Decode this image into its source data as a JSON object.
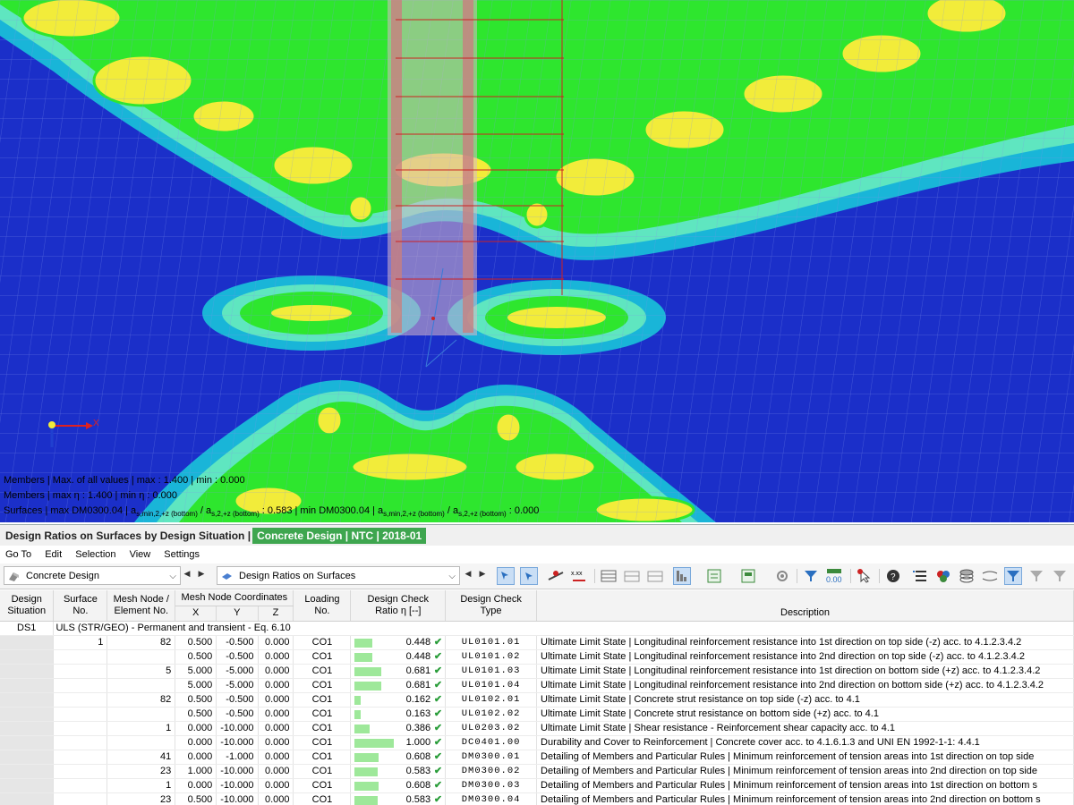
{
  "viewport": {
    "info_lines": [
      {
        "prefix": "Members | Max. of all values | max",
        "mid": ": 1.400 | min",
        "suffix": ": 0.000"
      },
      {
        "prefix": "Members | max η : 1.400 | min η : 0.000"
      },
      {
        "prefix": "Surfaces | max DM0300.04 | a",
        "sub1": "s,min,2,+z (bottom)",
        "mid1": " / a",
        "sub2": "s,2,+z (bottom)",
        "mid2": " : 0.583 | min DM0300.04 | a",
        "sub3": "s,min,2,+z (bottom)",
        "mid3": " / a",
        "sub4": "s,2,+z (bottom)",
        "suffix": " : 0.000"
      }
    ],
    "axis_x_label": "X"
  },
  "panel": {
    "title": "Design Ratios on Surfaces by Design Situation |",
    "badge": "Concrete Design | NTC | 2018-01"
  },
  "menu": [
    "Go To",
    "Edit",
    "Selection",
    "View",
    "Settings"
  ],
  "toolbar": {
    "module_combo": "Concrete Design",
    "result_combo": "Design Ratios on Surfaces",
    "icons": [
      "select-icon",
      "pick-icon",
      "result-values-icon",
      "decimal-icon",
      "table-icon",
      "table-insert-icon",
      "table-delete-icon",
      "chart-icon",
      "export-icon",
      "print-icon",
      "settings-icon",
      "filter-icon",
      "number-format-icon",
      "pointer-icon",
      "help-icon",
      "list-icon",
      "colors-icon",
      "layers-icon",
      "scale-icon",
      "filter-active-icon",
      "filter-clear-icon",
      "filter-option-icon"
    ]
  },
  "table": {
    "headers": {
      "design_situation": [
        "Design",
        "Situation"
      ],
      "surface_no": [
        "Surface",
        "No."
      ],
      "mesh_node": [
        "Mesh Node /",
        "Element No."
      ],
      "coords_group": "Mesh Node Coordinates",
      "x": "X",
      "y": "Y",
      "z": "Z",
      "loading": [
        "Loading",
        "No."
      ],
      "ratio": [
        "Design Check",
        "Ratio η [--]"
      ],
      "type": [
        "Design Check",
        "Type"
      ],
      "description": "Description"
    },
    "situation": "DS1",
    "group_title": "ULS (STR/GEO) - Permanent and transient - Eq. 6.10",
    "rows": [
      {
        "surface": "1",
        "node": "82",
        "x": "0.500",
        "y": "-0.500",
        "z": "0.000",
        "loading": "CO1",
        "ratio": 0.448,
        "ratio_text": "0.448",
        "type": "UL0101.01",
        "desc": "Ultimate Limit State | Longitudinal reinforcement resistance into 1st direction on top side (-z) acc. to 4.1.2.3.4.2"
      },
      {
        "surface": "",
        "node": "",
        "x": "0.500",
        "y": "-0.500",
        "z": "0.000",
        "loading": "CO1",
        "ratio": 0.448,
        "ratio_text": "0.448",
        "type": "UL0101.02",
        "desc": "Ultimate Limit State | Longitudinal reinforcement resistance into 2nd direction on top side (-z) acc. to 4.1.2.3.4.2"
      },
      {
        "surface": "",
        "node": "5",
        "x": "5.000",
        "y": "-5.000",
        "z": "0.000",
        "loading": "CO1",
        "ratio": 0.681,
        "ratio_text": "0.681",
        "type": "UL0101.03",
        "desc": "Ultimate Limit State | Longitudinal reinforcement resistance into 1st direction on bottom side (+z) acc. to 4.1.2.3.4.2"
      },
      {
        "surface": "",
        "node": "",
        "x": "5.000",
        "y": "-5.000",
        "z": "0.000",
        "loading": "CO1",
        "ratio": 0.681,
        "ratio_text": "0.681",
        "type": "UL0101.04",
        "desc": "Ultimate Limit State | Longitudinal reinforcement resistance into 2nd direction on bottom side (+z) acc. to 4.1.2.3.4.2"
      },
      {
        "surface": "",
        "node": "82",
        "x": "0.500",
        "y": "-0.500",
        "z": "0.000",
        "loading": "CO1",
        "ratio": 0.162,
        "ratio_text": "0.162",
        "type": "UL0102.01",
        "desc": "Ultimate Limit State | Concrete strut resistance on top side (-z) acc. to 4.1"
      },
      {
        "surface": "",
        "node": "",
        "x": "0.500",
        "y": "-0.500",
        "z": "0.000",
        "loading": "CO1",
        "ratio": 0.163,
        "ratio_text": "0.163",
        "type": "UL0102.02",
        "desc": "Ultimate Limit State | Concrete strut resistance on bottom side (+z) acc. to 4.1"
      },
      {
        "surface": "",
        "node": "1",
        "x": "0.000",
        "y": "-10.000",
        "z": "0.000",
        "loading": "CO1",
        "ratio": 0.386,
        "ratio_text": "0.386",
        "type": "UL0203.02",
        "desc": "Ultimate Limit State | Shear resistance - Reinforcement shear capacity acc. to 4.1"
      },
      {
        "surface": "",
        "node": "",
        "x": "0.000",
        "y": "-10.000",
        "z": "0.000",
        "loading": "CO1",
        "ratio": 1.0,
        "ratio_text": "1.000",
        "type": "DC0401.00",
        "desc": "Durability and Cover to Reinforcement | Concrete cover acc. to 4.1.6.1.3 and UNI EN 1992-1-1: 4.4.1"
      },
      {
        "surface": "",
        "node": "41",
        "x": "0.000",
        "y": "-1.000",
        "z": "0.000",
        "loading": "CO1",
        "ratio": 0.608,
        "ratio_text": "0.608",
        "type": "DM0300.01",
        "desc": "Detailing of Members and Particular Rules | Minimum reinforcement of tension areas into 1st direction on top side"
      },
      {
        "surface": "",
        "node": "23",
        "x": "1.000",
        "y": "-10.000",
        "z": "0.000",
        "loading": "CO1",
        "ratio": 0.583,
        "ratio_text": "0.583",
        "type": "DM0300.02",
        "desc": "Detailing of Members and Particular Rules | Minimum reinforcement of tension areas into 2nd direction on top side"
      },
      {
        "surface": "",
        "node": "1",
        "x": "0.000",
        "y": "-10.000",
        "z": "0.000",
        "loading": "CO1",
        "ratio": 0.608,
        "ratio_text": "0.608",
        "type": "DM0300.03",
        "desc": "Detailing of Members and Particular Rules | Minimum reinforcement of tension areas into 1st direction on bottom s"
      },
      {
        "surface": "",
        "node": "23",
        "x": "0.500",
        "y": "-10.000",
        "z": "0.000",
        "loading": "CO1",
        "ratio": 0.583,
        "ratio_text": "0.583",
        "type": "DM0300.04",
        "desc": "Detailing of Members and Particular Rules | Minimum reinforcement of tension areas into 2nd direction on bottom s"
      }
    ]
  },
  "colors": {
    "slab_blue": "#1b2fc9",
    "band_cyan": "#19b5d8",
    "band_light": "#5fe6c0",
    "band_green": "#2ee62e",
    "band_yellow": "#f2ec3a",
    "badge_green": "#3ea64f",
    "ratio_bar": "#9ee89a"
  }
}
